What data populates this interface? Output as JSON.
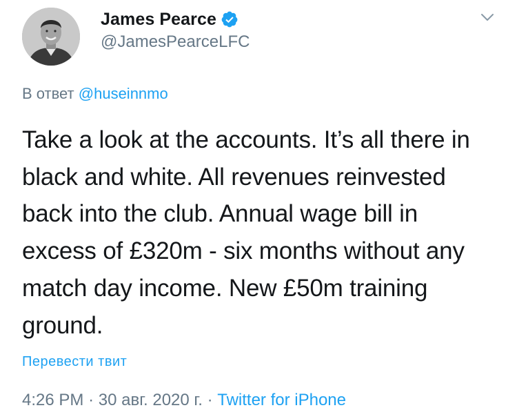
{
  "author": {
    "display_name": "James Pearce",
    "handle": "@JamesPearceLFC",
    "verified_icon": "verified-badge-icon",
    "avatar_icon": "profile-photo"
  },
  "reply": {
    "prefix": "В ответ",
    "mention": "@huseinnmo"
  },
  "tweet": {
    "text": "Take a look at the accounts. It’s all there in black and white. All revenues reinvested back into the club. Annual wage bill in excess of £320m - six months without any match day income. New £50m training ground."
  },
  "translate_label": "Перевести твит",
  "meta": {
    "time": "4:26 PM",
    "separator": "·",
    "date": "30 авг. 2020 г.",
    "source": "Twitter for iPhone"
  },
  "menu_icon": "chevron-down-icon",
  "colors": {
    "accent": "#1da1f2",
    "text": "#14171a",
    "muted": "#657786"
  }
}
